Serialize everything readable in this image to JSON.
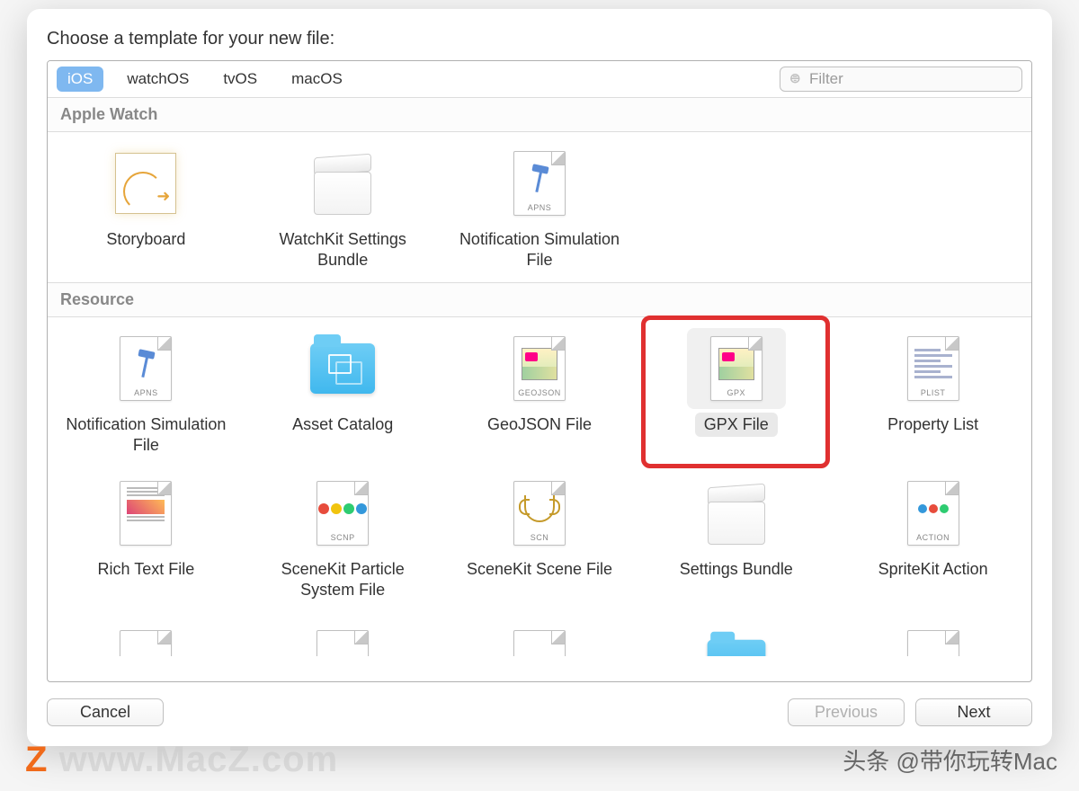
{
  "title": "Choose a template for your new file:",
  "tabs": {
    "ios": "iOS",
    "watchos": "watchOS",
    "tvos": "tvOS",
    "macos": "macOS",
    "selected": "ios"
  },
  "filter": {
    "placeholder": "Filter",
    "value": ""
  },
  "sections": {
    "applewatch": {
      "header": "Apple Watch",
      "items": {
        "storyboard": "Storyboard",
        "wksettings": "WatchKit Settings Bundle",
        "notifsim": "Notification Simulation File"
      }
    },
    "resource": {
      "header": "Resource",
      "items": {
        "notifsim2": "Notification Simulation File",
        "assetcat": "Asset Catalog",
        "geojson": "GeoJSON File",
        "gpx": "GPX File",
        "plist": "Property List",
        "rtf": "Rich Text File",
        "scnp": "SceneKit Particle System File",
        "scn": "SceneKit Scene File",
        "settingsbundle": "Settings Bundle",
        "skaction": "SpriteKit Action"
      }
    }
  },
  "icon_tags": {
    "apns": "APNS",
    "geojson": "GEOJSON",
    "gpx": "GPX",
    "plist": "PLIST",
    "scnp": "SCNP",
    "scn": "SCN",
    "action": "ACTION"
  },
  "buttons": {
    "cancel": "Cancel",
    "previous": "Previous",
    "next": "Next"
  },
  "selected_item": "gpx",
  "watermark_left": "www.MacZ.com",
  "watermark_right": "头条 @带你玩转Mac"
}
